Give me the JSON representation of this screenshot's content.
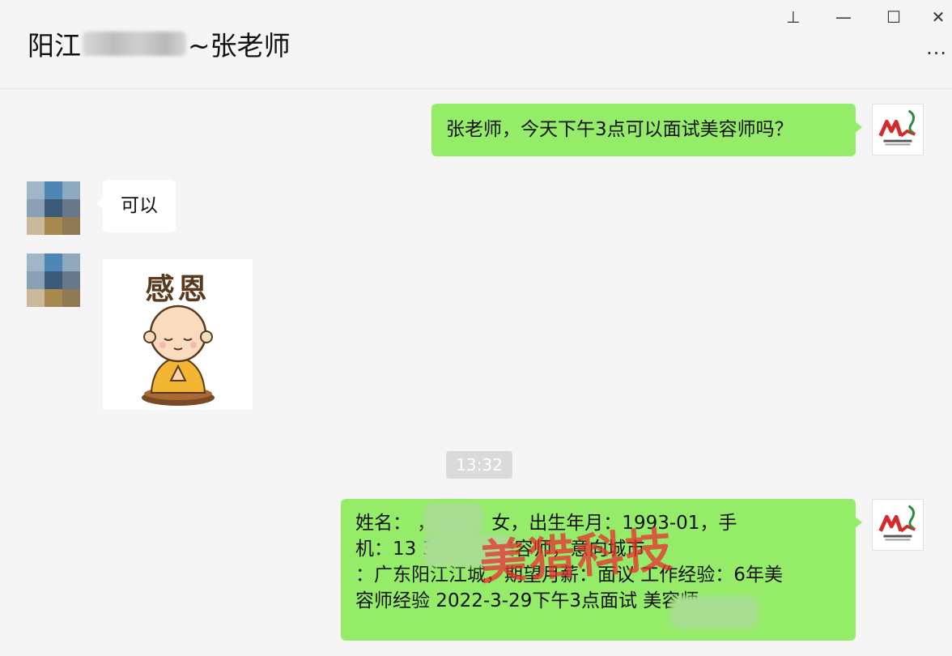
{
  "header": {
    "title_prefix": "阳江",
    "title_suffix": "~张老师"
  },
  "window_controls": {
    "pin_icon": "pin-icon",
    "minimize_icon": "minimize-icon",
    "maximize_icon": "maximize-icon",
    "close_icon": "close-icon",
    "more_icon": "more-icon",
    "pin_glyph": "⊥",
    "minimize_glyph": "—",
    "maximize_glyph": "☐",
    "close_glyph": "✕",
    "more_glyph": "···"
  },
  "messages": [
    {
      "direction": "outgoing",
      "type": "text",
      "text": "张老师，今天下午3点可以面试美容师吗？"
    },
    {
      "direction": "incoming",
      "type": "text",
      "text": "可以"
    },
    {
      "direction": "incoming",
      "type": "sticker",
      "caption": "感恩"
    },
    {
      "direction": "outgoing",
      "type": "text",
      "lines": [
        "姓名：               ，性别：女，出生年月：1993-01，手",
        "机：13                  3     职位：美容师，意向城市",
        "：广东阳江江城，期望月薪：面议 工作经验：6年美",
        "容师经验 2022-3-29下午3点面试                  美容师"
      ]
    }
  ],
  "timestamp": "13:32",
  "watermark": "美猎科技",
  "colors": {
    "outgoing_bubble": "#95ec69",
    "incoming_bubble": "#ffffff",
    "background": "#f5f5f5",
    "watermark": "#e82d2d"
  }
}
